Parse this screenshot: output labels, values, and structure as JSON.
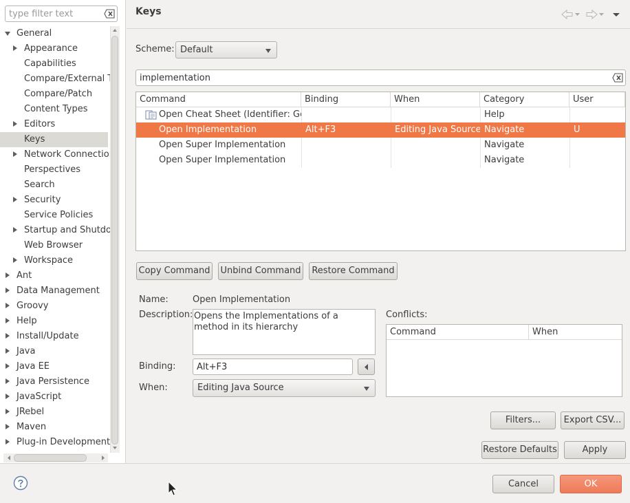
{
  "sidebar": {
    "filter_placeholder": "type filter text",
    "items": [
      {
        "label": "General",
        "level": 0,
        "expander": "down",
        "selected": false
      },
      {
        "label": "Appearance",
        "level": 1,
        "expander": "right",
        "selected": false
      },
      {
        "label": "Capabilities",
        "level": 1,
        "expander": "none",
        "selected": false
      },
      {
        "label": "Compare/External T",
        "level": 1,
        "expander": "none",
        "selected": false
      },
      {
        "label": "Compare/Patch",
        "level": 1,
        "expander": "none",
        "selected": false
      },
      {
        "label": "Content Types",
        "level": 1,
        "expander": "none",
        "selected": false
      },
      {
        "label": "Editors",
        "level": 1,
        "expander": "right",
        "selected": false
      },
      {
        "label": "Keys",
        "level": 1,
        "expander": "none",
        "selected": true
      },
      {
        "label": "Network Connectior",
        "level": 1,
        "expander": "right",
        "selected": false
      },
      {
        "label": "Perspectives",
        "level": 1,
        "expander": "none",
        "selected": false
      },
      {
        "label": "Search",
        "level": 1,
        "expander": "none",
        "selected": false
      },
      {
        "label": "Security",
        "level": 1,
        "expander": "right",
        "selected": false
      },
      {
        "label": "Service Policies",
        "level": 1,
        "expander": "none",
        "selected": false
      },
      {
        "label": "Startup and Shutdov",
        "level": 1,
        "expander": "right",
        "selected": false
      },
      {
        "label": "Web Browser",
        "level": 1,
        "expander": "none",
        "selected": false
      },
      {
        "label": "Workspace",
        "level": 1,
        "expander": "right",
        "selected": false
      },
      {
        "label": "Ant",
        "level": 0,
        "expander": "right",
        "selected": false
      },
      {
        "label": "Data Management",
        "level": 0,
        "expander": "right",
        "selected": false
      },
      {
        "label": "Groovy",
        "level": 0,
        "expander": "right",
        "selected": false
      },
      {
        "label": "Help",
        "level": 0,
        "expander": "right",
        "selected": false
      },
      {
        "label": "Install/Update",
        "level": 0,
        "expander": "right",
        "selected": false
      },
      {
        "label": "Java",
        "level": 0,
        "expander": "right",
        "selected": false
      },
      {
        "label": "Java EE",
        "level": 0,
        "expander": "right",
        "selected": false
      },
      {
        "label": "Java Persistence",
        "level": 0,
        "expander": "right",
        "selected": false
      },
      {
        "label": "JavaScript",
        "level": 0,
        "expander": "right",
        "selected": false
      },
      {
        "label": "JRebel",
        "level": 0,
        "expander": "right",
        "selected": false
      },
      {
        "label": "Maven",
        "level": 0,
        "expander": "right",
        "selected": false
      },
      {
        "label": "Plug-in Development",
        "level": 0,
        "expander": "right",
        "selected": false
      }
    ]
  },
  "page": {
    "title": "Keys",
    "scheme_label": "Scheme:",
    "scheme_value": "Default",
    "search_value": "implementation"
  },
  "table": {
    "columns": [
      "Command",
      "Binding",
      "When",
      "Category",
      "User"
    ],
    "rows": [
      {
        "command": "Open Cheat Sheet (Identifier: Gen",
        "binding": "",
        "when": "",
        "category": "Help",
        "user": "",
        "selected": false,
        "icon": "cheat-sheet-icon"
      },
      {
        "command": "Open Implementation",
        "binding": "Alt+F3",
        "when": "Editing Java Source",
        "category": "Navigate",
        "user": "U",
        "selected": true,
        "icon": ""
      },
      {
        "command": "Open Super Implementation",
        "binding": "",
        "when": "",
        "category": "Navigate",
        "user": "",
        "selected": false,
        "icon": ""
      },
      {
        "command": "Open Super Implementation",
        "binding": "",
        "when": "",
        "category": "Navigate",
        "user": "",
        "selected": false,
        "icon": ""
      }
    ]
  },
  "actions": {
    "copy": "Copy Command",
    "unbind": "Unbind Command",
    "restore": "Restore Command"
  },
  "details": {
    "name_label": "Name:",
    "name_value": "Open Implementation",
    "description_label": "Description:",
    "description_value": "Opens the Implementations of a method in its hierarchy",
    "binding_label": "Binding:",
    "binding_value": "Alt+F3",
    "when_label": "When:",
    "when_value": "Editing Java Source",
    "conflicts_label": "Conflicts:",
    "conflicts_columns": [
      "Command",
      "When"
    ]
  },
  "buttons": {
    "filters": "Filters...",
    "export": "Export CSV...",
    "restore_defaults": "Restore Defaults",
    "apply": "Apply",
    "cancel": "Cancel",
    "ok": "OK"
  },
  "colors": {
    "selection": "#f07746",
    "ok_button": "#ee7a58",
    "tree_selection": "#dcdad5"
  }
}
